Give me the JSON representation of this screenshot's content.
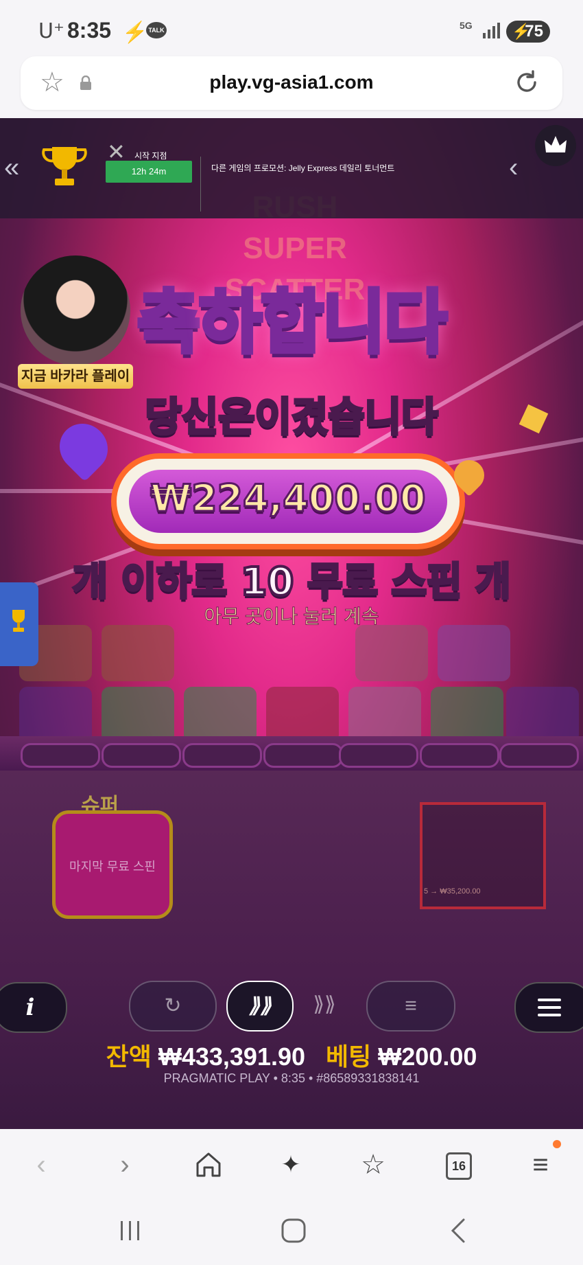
{
  "status_bar": {
    "carrier": "U⁺",
    "time": "8:35",
    "talk_badge": "TALK",
    "network": "5G",
    "battery": "75"
  },
  "browser": {
    "url": "play.vg-asia1.com",
    "tab_count": "16"
  },
  "tournament_banner": {
    "start_label": "시작 지점",
    "timer": "12h 24m",
    "promo_text": "다른 게임의 프로모션: Jelly Express 데일리 토너먼트"
  },
  "live_casino": {
    "label": "지금 바카라 플레이"
  },
  "game_logo": {
    "text": "RUSH SUPER SCATTER"
  },
  "win_popup": {
    "congrats_part1": "축",
    "congrats_part2": "하합니다",
    "you_won": "당신은이겼습니다",
    "amount": "₩224,400.00",
    "free_spins": "개 이하로 10 무료 스핀 개",
    "continue": "아무 곳이나 눌러 계속"
  },
  "panels": {
    "super_label": "슈퍼",
    "last_spin": "마지막 무료 스핀",
    "claw_label": "5  →  ₩35,200.00"
  },
  "controls": {
    "info": "i",
    "autoplay": "↻",
    "turbo": "⟫⟫",
    "bet_mode": "⟫⟫",
    "coins": "≡"
  },
  "balance": {
    "balance_label": "잔액",
    "balance_value": "₩433,391.90",
    "bet_label": "베팅",
    "bet_value": "₩200.00",
    "footer": "PRAGMATIC PLAY • 8:35 • #86589331838141"
  },
  "colors": {
    "accent_gold": "#f2b800",
    "popup_pink": "#e22a8a",
    "timer_green": "#2fa854"
  }
}
